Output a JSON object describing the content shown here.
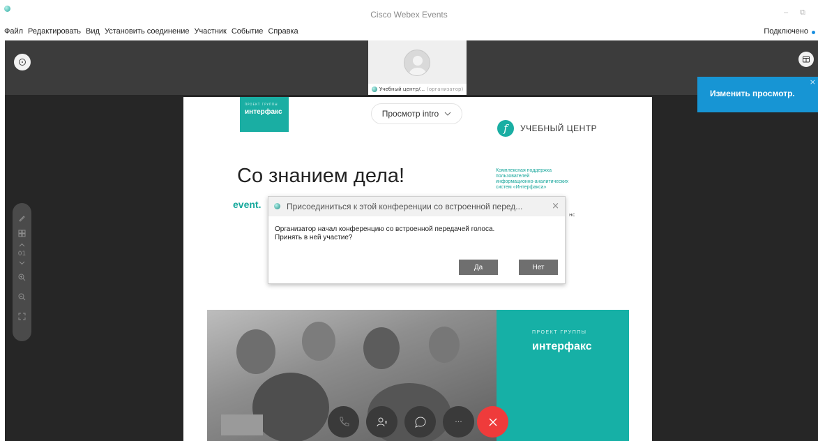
{
  "window": {
    "title": "Cisco Webex Events",
    "minimize": "–",
    "restore": "⧉"
  },
  "menu": {
    "items": [
      "Файл",
      "Редактировать",
      "Вид",
      "Установить соединение",
      "Участник",
      "Событие",
      "Справка"
    ],
    "status": "Подключено"
  },
  "participant": {
    "name": "Учебный центр/...",
    "role": "(организатор)"
  },
  "tooltip": {
    "text": "Изменить просмотр.",
    "close": "×"
  },
  "zoom_toolbar": {
    "page_number": "01"
  },
  "slide": {
    "logo_small": "ПРОЕКТ ГРУППЫ",
    "logo_word": "интерфакс",
    "view_select": "Просмотр intro",
    "center_logo_letter": "f",
    "center_text": "УЧЕБНЫЙ ЦЕНТР",
    "headline": "Со знанием дела!",
    "support_lines": [
      "Комплексная поддержка",
      "пользователей",
      "информационно-аналитических",
      "систем «Интерфакса»"
    ],
    "event_text": "event.",
    "right_fragment": "нс",
    "panel_small": "ПРОЕКТ ГРУППЫ",
    "panel_word": "интерфакс"
  },
  "dialog": {
    "title": "Присоединиться к этой конференции со встроенной перед...",
    "message_line1": "Организатор начал конференцию со встроенной передачей голоса.",
    "message_line2": "Принять в ней участие?",
    "yes_label": "Да",
    "no_label": "Нет",
    "close": "×"
  },
  "controls": {
    "more_label": "···"
  },
  "colors": {
    "accent_teal": "#1aaea3",
    "tooltip_blue": "#1795d4",
    "end_call_red": "#ef3b3b"
  }
}
